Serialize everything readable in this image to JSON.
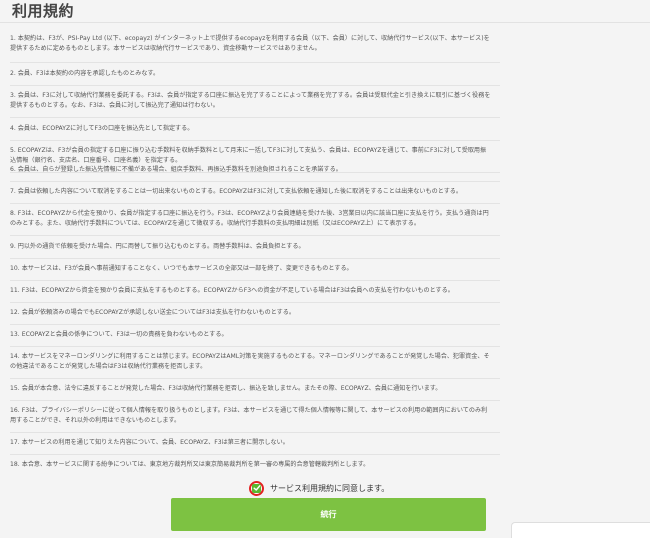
{
  "page": {
    "title": "利用規約"
  },
  "terms": [
    "1. 本契約は、F3が、PSI-Pay Ltd (以下、ecopayz) がインターネット上で提供するecopayzを利用する会員（以下、会員）に対して、収納代行サービス(以下、本サービス)を提供するために定めるものとします。本サービスは収納代行サービスであり、資金移動サービスではありません。",
    "2. 会員、F3は本契約の内容を承認したものとみなす。",
    "3. 会員は、F3に対して収納代行業務を委託する。F3は、会員が指定する口座に振込を完了することによって業務を完了する。会員は受取代金と引き換えに取引に基づく役務を提供するものとする。なお、F3は、会員に対して振込完了通知は行わない。",
    "4. 会員は、ECOPAYZに対してF3の口座を振込先として指定する。",
    "5. ECOPAYZは、F3が会員の指定する口座に振り込む手数料を収納手数料として月末に一括してF3に対して支払う、会員は、ECOPAYZを通じて、事前にF3に対して受取用振込情報（銀行名、支店名、口座番号、口座名義）を指定する。",
    "6. 会員は、自らが登録した振込先情報に不備がある場合、組戻手数料、再振込手数料を別途負担されることを承諾する。",
    "7. 会員は依頼した内容について取消をすることは一切出来ないものとする。ECOPAYZはF3に対して支払依頼を通知した後に取消をすることは出来ないものとする。",
    "8. F3は、ECOPAYZから代金を預かり、会員が指定する口座に振込を行う。F3は、ECOPAYZより会員連絡を受けた後、3営業日以内に該当口座に支払を行う。支払う通貨は円のみとする。また、収納代行手数料については、ECOPAYZを通じて徴収する。収納代行手数料の支払明細は別紙（又はECOPAYZ上）にて表示する。",
    "9. 円以外の通貨で依頼を受けた場合、円に両替して振り込むものとする。両替手数料は、会員負担とする。",
    "10. 本サービスは、F3が会員へ事前通知することなく、いつでも本サービスの全部又は一部を終了、変更できるものとする。",
    "11. F3は、ECOPAYZから資金を預かり会員に支払をするものとする。ECOPAYZからF3への資金が不足している場合はF3は会員への支払を行わないものとする。",
    "12. 会員が依頼済みの場合でもECOPAYZが承認しない送金についてはF3は支払を行わないものとする。",
    "13. ECOPAYZと会員の係争について、F3は一切の責務を負わないものとする。",
    "14. 本サービスをマネーロンダリングに利用することは禁じます。ECOPAYZはAML対策を実施するものとする。マネーロンダリングであることが発覚した場合、犯罪資金、その他違法であることが発覚した場合はF3は収納代行業務を拒否します。",
    "15. 会員が本合意、法令に違反することが発覚した場合、F3は収納代行業務を拒否し、振込を致しません。またその際、ECOPAYZ、会員に通知を行います。",
    "16. F3は、プライバシーポリシーに従って個人情報を取り扱うものとします。F3は、本サービスを通じて得た個人情報等に関して、本サービスの利用の範囲内においてのみ利用することができ、それ以外の利用はできないものとします。",
    "17. 本サービスの利用を通じて知りえた内容について、会員、ECOPAYZ、F3は第三者に開示しない。",
    "18. 本合意、本サービスに関する紛争については、東京地方裁判所又は東京簡易裁判所を第一審の専属的合意管轄裁判所とします。"
  ],
  "agree": {
    "label": "サービス利用規約に同意します。",
    "checked": true
  },
  "submit": {
    "label": "続行"
  }
}
